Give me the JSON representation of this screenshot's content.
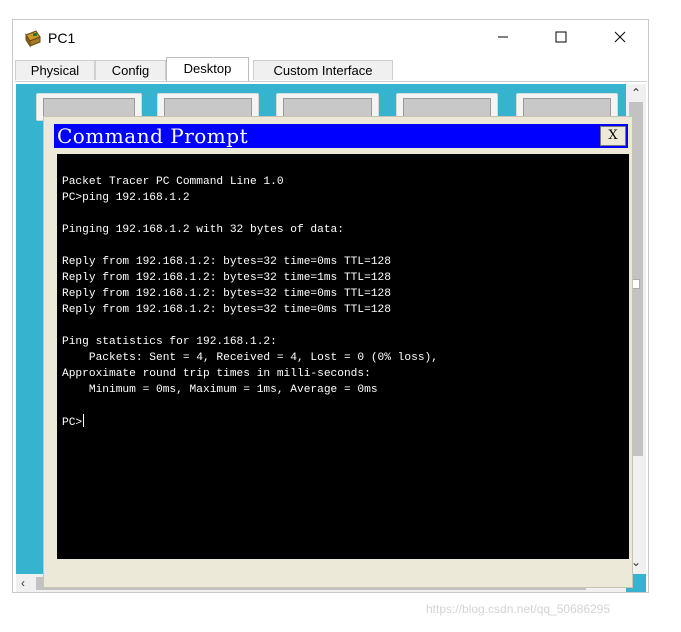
{
  "window": {
    "title": "PC1",
    "controls": {
      "minimize_icon": "minimize-icon",
      "maximize_icon": "maximize-icon",
      "close_icon": "close-icon"
    }
  },
  "tabs": [
    {
      "label": "Physical",
      "active": false
    },
    {
      "label": "Config",
      "active": false
    },
    {
      "label": "Desktop",
      "active": true
    },
    {
      "label": "Custom Interface",
      "active": false
    }
  ],
  "colors": {
    "desktop_background": "#35b3cf",
    "command_prompt_titlebar": "#0000ff",
    "terminal_background": "#000000",
    "terminal_text": "#ffffff"
  },
  "command_prompt": {
    "title": "Command Prompt",
    "close_label": "X",
    "terminal_lines": [
      "Packet Tracer PC Command Line 1.0",
      "PC>ping 192.168.1.2",
      "",
      "Pinging 192.168.1.2 with 32 bytes of data:",
      "",
      "Reply from 192.168.1.2: bytes=32 time=0ms TTL=128",
      "Reply from 192.168.1.2: bytes=32 time=1ms TTL=128",
      "Reply from 192.168.1.2: bytes=32 time=0ms TTL=128",
      "Reply from 192.168.1.2: bytes=32 time=0ms TTL=128",
      "",
      "Ping statistics for 192.168.1.2:",
      "    Packets: Sent = 4, Received = 4, Lost = 0 (0% loss),",
      "Approximate round trip times in milli-seconds:",
      "    Minimum = 0ms, Maximum = 1ms, Average = 0ms",
      "",
      "PC>"
    ]
  },
  "watermark": "https://blog.csdn.net/qq_50686295"
}
